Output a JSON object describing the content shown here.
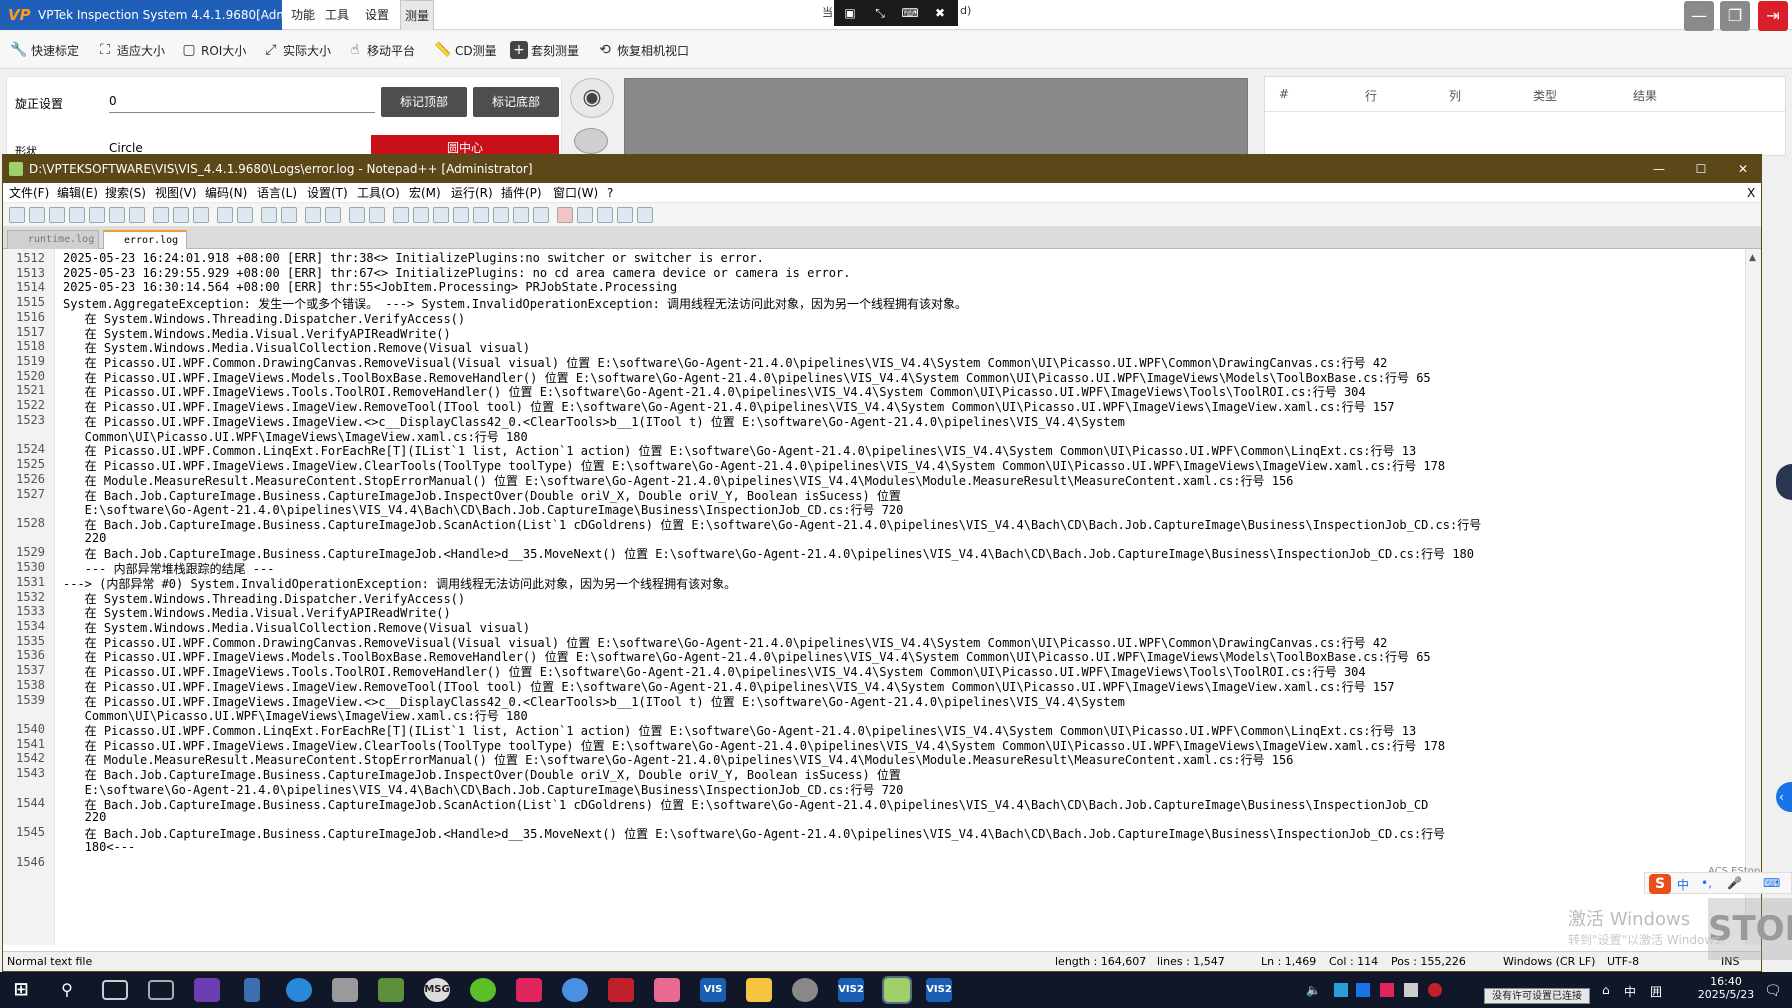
{
  "vptek": {
    "title": "VPTek Inspection System 4.4.1.9680[Admin]",
    "logo": "VP",
    "menu": [
      "功能",
      "工具",
      "设置",
      "测量"
    ],
    "toolbar": [
      "快速标定",
      "适应大小",
      "ROI大小",
      "实际大小",
      "移动平台",
      "CD测量",
      "套刻测量",
      "恢复相机视口"
    ],
    "rotation_label": "旋正设置",
    "rotation_value": "0",
    "shape_label": "形状",
    "shape_value": "Circle",
    "btn_top": "标记顶部",
    "btn_bottom": "标记底部",
    "btn_circle_center": "圆中心",
    "remote_tail": "d)",
    "remote_left": "当",
    "table_headers": [
      "#",
      "行",
      "列",
      "类型",
      "结果"
    ]
  },
  "notepad": {
    "title": "D:\\VPTEKSOFTWARE\\VIS\\VIS_4.4.1.9680\\Logs\\error.log - Notepad++ [Administrator]",
    "menu": [
      "文件(F)",
      "编辑(E)",
      "搜索(S)",
      "视图(V)",
      "编码(N)",
      "语言(L)",
      "设置(T)",
      "工具(O)",
      "宏(M)",
      "运行(R)",
      "插件(P)",
      "窗口(W)",
      "?"
    ],
    "close_doc": "X",
    "tabs": [
      "runtime.log",
      "error.log"
    ],
    "lines": [
      {
        "n": "1512",
        "t": "2025-05-23 16:24:01.918 +08:00 [ERR] thr:38<> InitializePlugins:no switcher or switcher is error."
      },
      {
        "n": "1513",
        "t": "2025-05-23 16:29:55.929 +08:00 [ERR] thr:67<> InitializePlugins: no cd area camera device or camera is error."
      },
      {
        "n": "1514",
        "t": "2025-05-23 16:30:14.564 +08:00 [ERR] thr:55<JobItem.Processing> PRJobState.Processing"
      },
      {
        "n": "1515",
        "t": "System.AggregateException: 发生一个或多个错误。 ---> System.InvalidOperationException: 调用线程无法访问此对象，因为另一个线程拥有该对象。"
      },
      {
        "n": "1516",
        "t": "   在 System.Windows.Threading.Dispatcher.VerifyAccess()"
      },
      {
        "n": "1517",
        "t": "   在 System.Windows.Media.Visual.VerifyAPIReadWrite()"
      },
      {
        "n": "1518",
        "t": "   在 System.Windows.Media.VisualCollection.Remove(Visual visual)"
      },
      {
        "n": "1519",
        "t": "   在 Picasso.UI.WPF.Common.DrawingCanvas.RemoveVisual(Visual visual) 位置 E:\\software\\Go-Agent-21.4.0\\pipelines\\VIS_V4.4\\System Common\\UI\\Picasso.UI.WPF\\Common\\DrawingCanvas.cs:行号 42"
      },
      {
        "n": "1520",
        "t": "   在 Picasso.UI.WPF.ImageViews.Models.ToolBoxBase.RemoveHandler() 位置 E:\\software\\Go-Agent-21.4.0\\pipelines\\VIS_V4.4\\System Common\\UI\\Picasso.UI.WPF\\ImageViews\\Models\\ToolBoxBase.cs:行号 65"
      },
      {
        "n": "1521",
        "t": "   在 Picasso.UI.WPF.ImageViews.Tools.ToolROI.RemoveHandler() 位置 E:\\software\\Go-Agent-21.4.0\\pipelines\\VIS_V4.4\\System Common\\UI\\Picasso.UI.WPF\\ImageViews\\Tools\\ToolROI.cs:行号 304"
      },
      {
        "n": "1522",
        "t": "   在 Picasso.UI.WPF.ImageViews.ImageView.RemoveTool(ITool tool) 位置 E:\\software\\Go-Agent-21.4.0\\pipelines\\VIS_V4.4\\System Common\\UI\\Picasso.UI.WPF\\ImageViews\\ImageView.xaml.cs:行号 157"
      },
      {
        "n": "1523",
        "t": "   在 Picasso.UI.WPF.ImageViews.ImageView.<>c__DisplayClass42_0.<ClearTools>b__1(ITool t) 位置 E:\\software\\Go-Agent-21.4.0\\pipelines\\VIS_V4.4\\System"
      },
      {
        "n": "",
        "t": "   Common\\UI\\Picasso.UI.WPF\\ImageViews\\ImageView.xaml.cs:行号 180"
      },
      {
        "n": "1524",
        "t": "   在 Picasso.UI.WPF.Common.LinqExt.ForEachRe[T](IList`1 list, Action`1 action) 位置 E:\\software\\Go-Agent-21.4.0\\pipelines\\VIS_V4.4\\System Common\\UI\\Picasso.UI.WPF\\Common\\LinqExt.cs:行号 13"
      },
      {
        "n": "1525",
        "t": "   在 Picasso.UI.WPF.ImageViews.ImageView.ClearTools(ToolType toolType) 位置 E:\\software\\Go-Agent-21.4.0\\pipelines\\VIS_V4.4\\System Common\\UI\\Picasso.UI.WPF\\ImageViews\\ImageView.xaml.cs:行号 178"
      },
      {
        "n": "1526",
        "t": "   在 Module.MeasureResult.MeasureContent.StopErrorManual() 位置 E:\\software\\Go-Agent-21.4.0\\pipelines\\VIS_V4.4\\Modules\\Module.MeasureResult\\MeasureContent.xaml.cs:行号 156"
      },
      {
        "n": "1527",
        "t": "   在 Bach.Job.CaptureImage.Business.CaptureImageJob.InspectOver(Double oriV_X, Double oriV_Y, Boolean isSucess) 位置"
      },
      {
        "n": "",
        "t": "   E:\\software\\Go-Agent-21.4.0\\pipelines\\VIS_V4.4\\Bach\\CD\\Bach.Job.CaptureImage\\Business\\InspectionJob_CD.cs:行号 720"
      },
      {
        "n": "1528",
        "t": "   在 Bach.Job.CaptureImage.Business.CaptureImageJob.ScanAction(List`1 cDGoldrens) 位置 E:\\software\\Go-Agent-21.4.0\\pipelines\\VIS_V4.4\\Bach\\CD\\Bach.Job.CaptureImage\\Business\\InspectionJob_CD.cs:行号"
      },
      {
        "n": "",
        "t": "   220"
      },
      {
        "n": "1529",
        "t": "   在 Bach.Job.CaptureImage.Business.CaptureImageJob.<Handle>d__35.MoveNext() 位置 E:\\software\\Go-Agent-21.4.0\\pipelines\\VIS_V4.4\\Bach\\CD\\Bach.Job.CaptureImage\\Business\\InspectionJob_CD.cs:行号 180"
      },
      {
        "n": "1530",
        "t": "   --- 内部异常堆栈跟踪的结尾 ---"
      },
      {
        "n": "1531",
        "t": "---> (内部异常 #0) System.InvalidOperationException: 调用线程无法访问此对象，因为另一个线程拥有该对象。"
      },
      {
        "n": "1532",
        "t": "   在 System.Windows.Threading.Dispatcher.VerifyAccess()"
      },
      {
        "n": "1533",
        "t": "   在 System.Windows.Media.Visual.VerifyAPIReadWrite()"
      },
      {
        "n": "1534",
        "t": "   在 System.Windows.Media.VisualCollection.Remove(Visual visual)"
      },
      {
        "n": "1535",
        "t": "   在 Picasso.UI.WPF.Common.DrawingCanvas.RemoveVisual(Visual visual) 位置 E:\\software\\Go-Agent-21.4.0\\pipelines\\VIS_V4.4\\System Common\\UI\\Picasso.UI.WPF\\Common\\DrawingCanvas.cs:行号 42"
      },
      {
        "n": "1536",
        "t": "   在 Picasso.UI.WPF.ImageViews.Models.ToolBoxBase.RemoveHandler() 位置 E:\\software\\Go-Agent-21.4.0\\pipelines\\VIS_V4.4\\System Common\\UI\\Picasso.UI.WPF\\ImageViews\\Models\\ToolBoxBase.cs:行号 65"
      },
      {
        "n": "1537",
        "t": "   在 Picasso.UI.WPF.ImageViews.Tools.ToolROI.RemoveHandler() 位置 E:\\software\\Go-Agent-21.4.0\\pipelines\\VIS_V4.4\\System Common\\UI\\Picasso.UI.WPF\\ImageViews\\Tools\\ToolROI.cs:行号 304"
      },
      {
        "n": "1538",
        "t": "   在 Picasso.UI.WPF.ImageViews.ImageView.RemoveTool(ITool tool) 位置 E:\\software\\Go-Agent-21.4.0\\pipelines\\VIS_V4.4\\System Common\\UI\\Picasso.UI.WPF\\ImageViews\\ImageView.xaml.cs:行号 157"
      },
      {
        "n": "1539",
        "t": "   在 Picasso.UI.WPF.ImageViews.ImageView.<>c__DisplayClass42_0.<ClearTools>b__1(ITool t) 位置 E:\\software\\Go-Agent-21.4.0\\pipelines\\VIS_V4.4\\System"
      },
      {
        "n": "",
        "t": "   Common\\UI\\Picasso.UI.WPF\\ImageViews\\ImageView.xaml.cs:行号 180"
      },
      {
        "n": "1540",
        "t": "   在 Picasso.UI.WPF.Common.LinqExt.ForEachRe[T](IList`1 list, Action`1 action) 位置 E:\\software\\Go-Agent-21.4.0\\pipelines\\VIS_V4.4\\System Common\\UI\\Picasso.UI.WPF\\Common\\LinqExt.cs:行号 13"
      },
      {
        "n": "1541",
        "t": "   在 Picasso.UI.WPF.ImageViews.ImageView.ClearTools(ToolType toolType) 位置 E:\\software\\Go-Agent-21.4.0\\pipelines\\VIS_V4.4\\System Common\\UI\\Picasso.UI.WPF\\ImageViews\\ImageView.xaml.cs:行号 178"
      },
      {
        "n": "1542",
        "t": "   在 Module.MeasureResult.MeasureContent.StopErrorManual() 位置 E:\\software\\Go-Agent-21.4.0\\pipelines\\VIS_V4.4\\Modules\\Module.MeasureResult\\MeasureContent.xaml.cs:行号 156"
      },
      {
        "n": "1543",
        "t": "   在 Bach.Job.CaptureImage.Business.CaptureImageJob.InspectOver(Double oriV_X, Double oriV_Y, Boolean isSucess) 位置"
      },
      {
        "n": "",
        "t": "   E:\\software\\Go-Agent-21.4.0\\pipelines\\VIS_V4.4\\Bach\\CD\\Bach.Job.CaptureImage\\Business\\InspectionJob_CD.cs:行号 720"
      },
      {
        "n": "1544",
        "t": "   在 Bach.Job.CaptureImage.Business.CaptureImageJob.ScanAction(List`1 cDGoldrens) 位置 E:\\software\\Go-Agent-21.4.0\\pipelines\\VIS_V4.4\\Bach\\CD\\Bach.Job.CaptureImage\\Business\\InspectionJob_CD"
      },
      {
        "n": "",
        "t": "   220"
      },
      {
        "n": "1545",
        "t": "   在 Bach.Job.CaptureImage.Business.CaptureImageJob.<Handle>d__35.MoveNext() 位置 E:\\software\\Go-Agent-21.4.0\\pipelines\\VIS_V4.4\\Bach\\CD\\Bach.Job.CaptureImage\\Business\\InspectionJob_CD.cs:行号"
      },
      {
        "n": "",
        "t": "   180<---"
      },
      {
        "n": "1546",
        "t": ""
      }
    ],
    "status": {
      "type": "Normal text file",
      "length": "length : 164,607",
      "lines": "lines : 1,547",
      "ln": "Ln : 1,469",
      "col": "Col : 114",
      "pos": "Pos : 155,226",
      "eol": "Windows (CR LF)",
      "encoding": "UTF-8",
      "ins": "INS"
    }
  },
  "overlay": {
    "activate_line1": "激活 Windows",
    "activate_line2": "转到\"设置\"以激活 Windows。",
    "acs": "ACS EStop",
    "stop": "STOP",
    "tooltip": "没有许可设置已连接"
  },
  "taskbar": {
    "time": "16:40",
    "date": "2025/5/23",
    "ime": "中",
    "apps": [
      "Edge",
      "Folder",
      "MSG",
      "VS",
      "VIS",
      "Notepad",
      "VIS2"
    ]
  },
  "colors": {
    "vp_blue": "#1f5fb8",
    "np_title": "#5b4718",
    "taskbar": "#101728",
    "red_button": "#c9101a"
  }
}
